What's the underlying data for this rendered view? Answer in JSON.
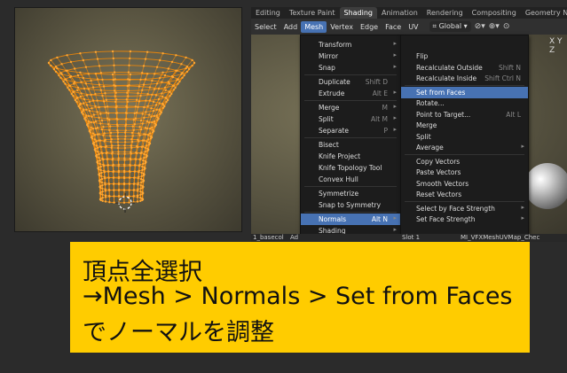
{
  "workspace_tabs": [
    {
      "label": "Editing",
      "active": false
    },
    {
      "label": "Texture Paint",
      "active": false
    },
    {
      "label": "Shading",
      "active": true
    },
    {
      "label": "Animation",
      "active": false
    },
    {
      "label": "Rendering",
      "active": false
    },
    {
      "label": "Compositing",
      "active": false
    },
    {
      "label": "Geometry N",
      "active": false
    }
  ],
  "header_menu": [
    {
      "label": "Select",
      "active": false
    },
    {
      "label": "Add",
      "active": false
    },
    {
      "label": "Mesh",
      "active": true
    },
    {
      "label": "Vertex",
      "active": false
    },
    {
      "label": "Edge",
      "active": false
    },
    {
      "label": "Face",
      "active": false
    },
    {
      "label": "UV",
      "active": false
    }
  ],
  "orientation": "Global",
  "axis_label": "X Y Z",
  "mesh_menu": {
    "items": [
      {
        "label": "Transform",
        "shortcut": "",
        "submenu": true
      },
      {
        "label": "Mirror",
        "shortcut": "",
        "submenu": true
      },
      {
        "label": "Snap",
        "shortcut": "",
        "submenu": true
      },
      {
        "label": "Duplicate",
        "shortcut": "Shift D",
        "submenu": false
      },
      {
        "label": "Extrude",
        "shortcut": "Alt E",
        "submenu": true
      },
      {
        "label": "Merge",
        "shortcut": "M",
        "submenu": true
      },
      {
        "label": "Split",
        "shortcut": "Alt M",
        "submenu": true
      },
      {
        "label": "Separate",
        "shortcut": "P",
        "submenu": true
      },
      {
        "label": "Bisect",
        "shortcut": "",
        "submenu": false
      },
      {
        "label": "Knife Project",
        "shortcut": "",
        "submenu": false
      },
      {
        "label": "Knife Topology Tool",
        "shortcut": "",
        "submenu": false
      },
      {
        "label": "Convex Hull",
        "shortcut": "",
        "submenu": false
      },
      {
        "label": "Symmetrize",
        "shortcut": "",
        "submenu": false
      },
      {
        "label": "Snap to Symmetry",
        "shortcut": "",
        "submenu": false
      },
      {
        "label": "Normals",
        "shortcut": "Alt N",
        "submenu": true
      },
      {
        "label": "Shading",
        "shortcut": "",
        "submenu": true
      }
    ],
    "highlighted": "Normals"
  },
  "normals_menu": {
    "items": [
      {
        "label": "Flip",
        "shortcut": "",
        "submenu": false
      },
      {
        "label": "Recalculate Outside",
        "shortcut": "Shift N",
        "submenu": false
      },
      {
        "label": "Recalculate Inside",
        "shortcut": "Shift Ctrl N",
        "submenu": false
      },
      {
        "label": "Set from Faces",
        "shortcut": "",
        "submenu": false
      },
      {
        "label": "Rotate...",
        "shortcut": "",
        "submenu": false
      },
      {
        "label": "Point to Target...",
        "shortcut": "Alt L",
        "submenu": false
      },
      {
        "label": "Merge",
        "shortcut": "",
        "submenu": false
      },
      {
        "label": "Split",
        "shortcut": "",
        "submenu": false
      },
      {
        "label": "Average",
        "shortcut": "",
        "submenu": true
      },
      {
        "label": "Copy Vectors",
        "shortcut": "",
        "submenu": false
      },
      {
        "label": "Paste Vectors",
        "shortcut": "",
        "submenu": false
      },
      {
        "label": "Smooth Vectors",
        "shortcut": "",
        "submenu": false
      },
      {
        "label": "Reset Vectors",
        "shortcut": "",
        "submenu": false
      },
      {
        "label": "Select by Face Strength",
        "shortcut": "",
        "submenu": true
      },
      {
        "label": "Set Face Strength",
        "shortcut": "",
        "submenu": true
      }
    ],
    "highlighted": "Set from Faces"
  },
  "bottom_bar": {
    "object_name": "1_basecol",
    "mode_short": "Ad",
    "slot": "Slot 1",
    "material": "MI_VFXMeshUVMap_Chec"
  },
  "caption": {
    "line1": "頂点全選択",
    "line2": "→Mesh > Normals > Set from Faces",
    "line3": "でノーマルを調整"
  },
  "colors": {
    "accent": "#4772b3",
    "selection": "#ff8c00",
    "caption_bg": "#ffcc00"
  }
}
